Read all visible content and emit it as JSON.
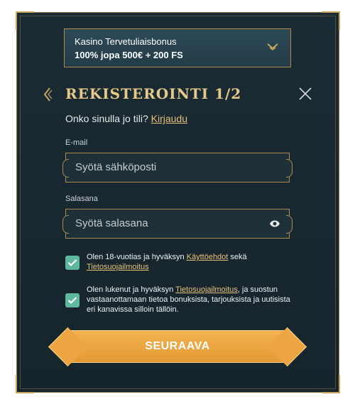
{
  "bonus": {
    "line1": "Kasino Tervetuliaisbonus",
    "line2": "100% jopa 500€ + 200 FS"
  },
  "header": {
    "title": "REKISTEROINTI 1/2"
  },
  "login_prompt": {
    "text": "Onko sinulla jo tili?",
    "link": "Kirjaudu"
  },
  "email": {
    "label": "E-mail",
    "placeholder": "Syötä sähköposti"
  },
  "password": {
    "label": "Salasana",
    "placeholder": "Syötä salasana"
  },
  "terms": {
    "checked": true,
    "text_before": "Olen 18-vuotias ja hyväksyn",
    "link1": "Käyttöehdot",
    "text_mid": "sekä",
    "link2": "Tietosuojailmoitus"
  },
  "marketing": {
    "checked": true,
    "text_before": "Olen lukenut ja hyväksyn",
    "link": "Tietosuojailmoitus",
    "text_after": ", ja suostun vastaanottamaan tietoa bonuksista, tarjouksista ja uutisista eri kanavissa silloin tällöin."
  },
  "cta": {
    "label": "SEURAAVA"
  },
  "colors": {
    "accent_gold": "#e7c98a",
    "button_orange": "#eca542",
    "checkbox_teal": "#5eb8a0",
    "background": "#1b2b33"
  },
  "icons": {
    "chevron": "chevron-down-icon",
    "back": "back-arrow-icon",
    "close": "close-icon",
    "eye": "eye-icon",
    "check": "check-icon"
  }
}
